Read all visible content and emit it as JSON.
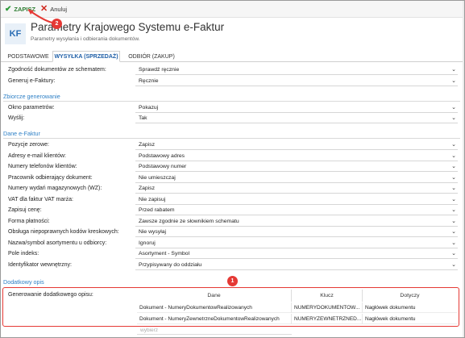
{
  "toolbar": {
    "save_label": "ZAPISZ",
    "cancel_label": "Anuluj"
  },
  "header": {
    "logo": "KF",
    "title": "Parametry Krajowego Systemu e-Faktur",
    "subtitle": "Parametry wysyłania i odbierania dokumentów."
  },
  "tabs": [
    "PODSTAWOWE",
    "WYSYŁKA (SPRZEDAŻ)",
    "ODBIÓR (ZAKUP)"
  ],
  "active_tab": "WYSYŁKA (SPRZEDAŻ)",
  "top_rows": [
    {
      "label": "Zgodność dokumentów ze schematem:",
      "value": "Sprawdź ręcznie"
    },
    {
      "label": "Generuj e-Faktury:",
      "value": "Ręcznie"
    }
  ],
  "sections": {
    "zbiorcze": "Zbiorcze generowanie",
    "dane": "Dane e-Faktur",
    "opis": "Dodatkowy opis"
  },
  "zbiorcze_rows": [
    {
      "label": "Okno parametrów:",
      "value": "Pokazuj"
    },
    {
      "label": "Wyślij:",
      "value": "Tak"
    }
  ],
  "dane_rows": [
    {
      "label": "Pozycje zerowe:",
      "value": "Zapisz"
    },
    {
      "label": "Adresy e-mail klientów:",
      "value": "Podstawowy adres"
    },
    {
      "label": "Numery telefonów klientów:",
      "value": "Podstawowy numer"
    },
    {
      "label": "Pracownik odbierający dokument:",
      "value": "Nie umieszczaj"
    },
    {
      "label": "Numery wydań magazynowych (WZ):",
      "value": "Zapisz"
    },
    {
      "label": "VAT dla faktur VAT marża:",
      "value": "Nie zapisuj"
    },
    {
      "label": "Zapisuj cenę:",
      "value": "Przed rabatem"
    },
    {
      "label": "Forma płatności:",
      "value": "Zawsze zgodnie ze słownikiem schematu"
    },
    {
      "label": "Obsługa niepoprawnych kodów kreskowych:",
      "value": "Nie wysyłaj"
    },
    {
      "label": "Nazwa/symbol asortymentu u odbiorcy:",
      "value": "Ignoruj"
    },
    {
      "label": "Pole indeks:",
      "value": "Asortyment - Symbol"
    },
    {
      "label": "Identyfikator wewnętrzny:",
      "value": "Przypisywany do oddziału"
    }
  ],
  "opis": {
    "label": "Generowanie dodatkowego opisu:",
    "columns": [
      "Dane",
      "Klucz",
      "Dotyczy"
    ],
    "rows": [
      [
        "Dokument - NumeryDokumentowRealizowanych",
        "NUMERYDOKUMENTOW...",
        "Nagłówek dokumentu"
      ],
      [
        "Dokument - NumeryZewnetrzneDokumentowRealizowanych",
        "NUMERYZEWNETRZNED...",
        "Nagłówek dokumentu"
      ]
    ],
    "placeholder": "wybierz"
  },
  "annotations": {
    "badge1": "1",
    "badge2": "2"
  },
  "colors": {
    "accent": "#2f80c6",
    "highlight": "#e53935",
    "save": "#2e7d32"
  }
}
